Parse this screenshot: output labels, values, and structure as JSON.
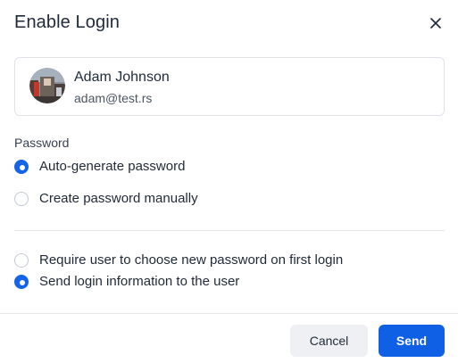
{
  "dialog": {
    "title": "Enable Login",
    "close_icon": "close-icon"
  },
  "user": {
    "name": "Adam Johnson",
    "email": "adam@test.rs",
    "avatar_icon": "avatar"
  },
  "password": {
    "label": "Password",
    "options": [
      {
        "label": "Auto-generate password",
        "checked": true
      },
      {
        "label": "Create password manually",
        "checked": false
      }
    ]
  },
  "settings": {
    "options": [
      {
        "label": "Require user to choose new password on first login",
        "checked": false
      },
      {
        "label": "Send login information to the user",
        "checked": true
      }
    ]
  },
  "footer": {
    "cancel_label": "Cancel",
    "send_label": "Send"
  },
  "colors": {
    "accent": "#1463e8",
    "cancel_bg": "#eef0f3",
    "border": "#dfe3e8"
  }
}
